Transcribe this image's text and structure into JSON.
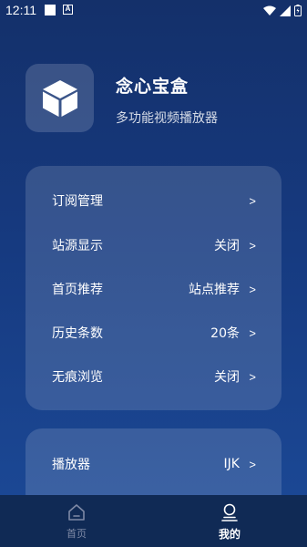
{
  "status_bar": {
    "time": "12:11",
    "notification_a": "A",
    "icons": [
      "square-notification-icon",
      "a-notification-icon",
      "wifi-icon",
      "signal-icon",
      "battery-icon"
    ]
  },
  "header": {
    "app_name": "念心宝盒",
    "subtitle": "多功能视频播放器",
    "icon": "cube-icon"
  },
  "settings_group_1": [
    {
      "label": "订阅管理",
      "value": ""
    },
    {
      "label": "站源显示",
      "value": "关闭"
    },
    {
      "label": "首页推荐",
      "value": "站点推荐"
    },
    {
      "label": "历史条数",
      "value": "20条"
    },
    {
      "label": "无痕浏览",
      "value": "关闭"
    }
  ],
  "settings_group_2": [
    {
      "label": "播放器",
      "value": "IJK"
    }
  ],
  "chevron": ">",
  "tab_bar": {
    "tabs": [
      {
        "label": "首页",
        "icon": "home-icon",
        "active": false
      },
      {
        "label": "我的",
        "icon": "user-icon",
        "active": true
      }
    ]
  },
  "colors": {
    "background_top": "#14306a",
    "background_bottom": "#1c4a98",
    "tab_bar": "#102a55",
    "inactive_tab": "#7f8aa6"
  }
}
